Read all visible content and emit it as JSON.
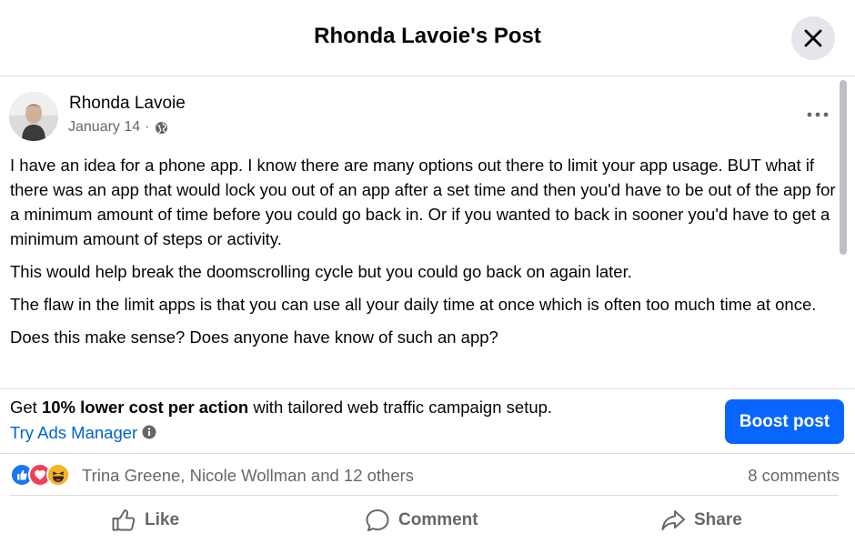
{
  "dialog": {
    "title": "Rhonda Lavoie's Post",
    "close_icon": "close-icon"
  },
  "post": {
    "author": "Rhonda Lavoie",
    "date": "January 14",
    "separator": "·",
    "audience_icon": "globe-icon",
    "more_icon": "more-horizontal-icon",
    "paragraphs": [
      "I have an idea for a phone app.  I know there are many options out there to limit your app usage.  BUT what if there was an app that would lock you out of an app after a set time and then you'd have to be out of the app for a minimum amount of time before you could go back in.  Or if you wanted to back in sooner you'd have to get a minimum amount of steps or activity.",
      "This would help break the doomscrolling cycle but you could go back on again later.",
      "The flaw in the limit apps is that you can use all your daily time at once which is often too much time at once.",
      "Does this make sense?  Does anyone have know of such an app?"
    ]
  },
  "boost": {
    "text_prefix": "Get ",
    "text_bold": "10% lower cost per action",
    "text_suffix": " with tailored web traffic campaign setup. ",
    "link": "Try Ads Manager",
    "info_icon": "info-icon",
    "button_label": "Boost post",
    "button_color": "#0866ff"
  },
  "engagement": {
    "reaction_icons": [
      "like-reaction-icon",
      "love-reaction-icon",
      "haha-reaction-icon"
    ],
    "reactors": "Trina Greene, Nicole Wollman and 12 others",
    "comments": "8 comments"
  },
  "actions": {
    "like": "Like",
    "comment": "Comment",
    "share": "Share"
  },
  "colors": {
    "accent_blue": "#0866ff",
    "link_blue": "#0064d1",
    "secondary_text": "#65676b",
    "divider": "#dadde1"
  }
}
